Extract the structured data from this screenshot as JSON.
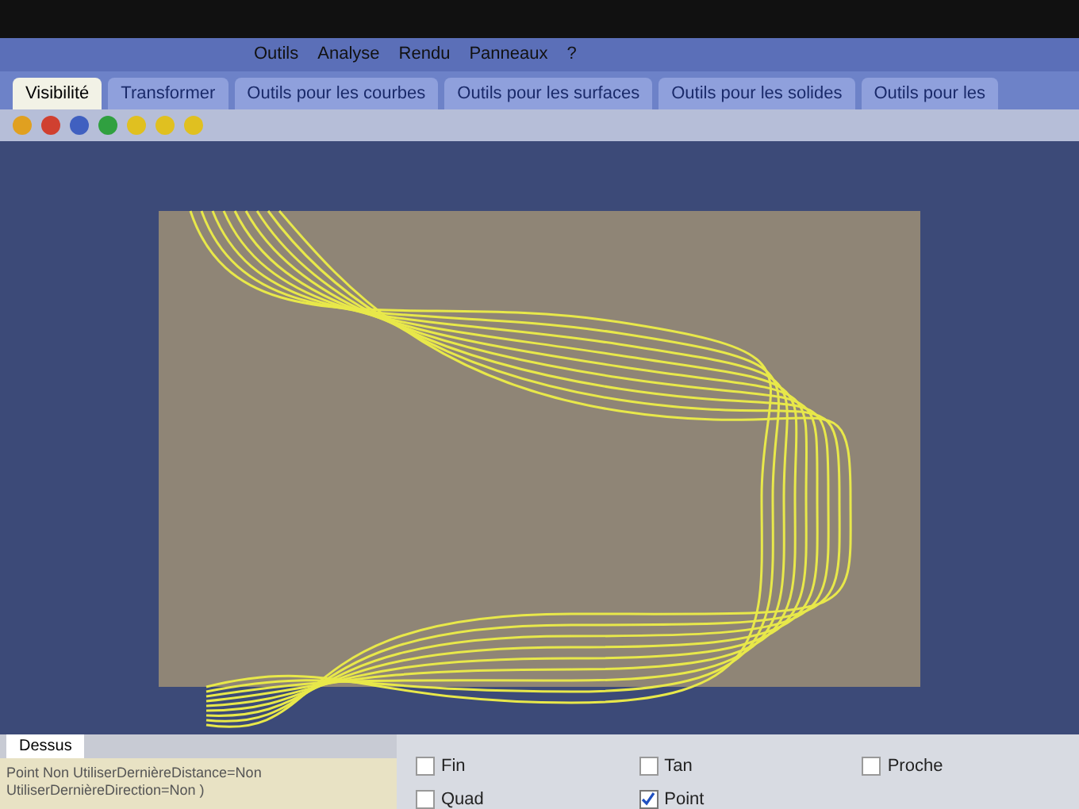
{
  "menu_bar": [
    "Outils",
    "Analyse",
    "Rendu",
    "Panneaux",
    "?"
  ],
  "tabs": [
    {
      "label": "Visibilité",
      "selected": true
    },
    {
      "label": "Transformer",
      "selected": false
    },
    {
      "label": "Outils pour les courbes",
      "selected": false
    },
    {
      "label": "Outils pour les surfaces",
      "selected": false
    },
    {
      "label": "Outils pour les solides",
      "selected": false
    },
    {
      "label": "Outils pour les",
      "selected": false
    }
  ],
  "viewport_tabs": [
    {
      "label": "Dessus",
      "selected": true
    }
  ],
  "command_history": [
    "Point Non UtiliserDernièreDistance=Non UtiliserDernièreDirection=Non )"
  ],
  "osnaps": [
    {
      "label": "Fin",
      "checked": false
    },
    {
      "label": "Tan",
      "checked": false
    },
    {
      "label": "Proche",
      "checked": false
    },
    {
      "label": "Quad",
      "checked": false
    },
    {
      "label": "Point",
      "checked": true
    }
  ]
}
